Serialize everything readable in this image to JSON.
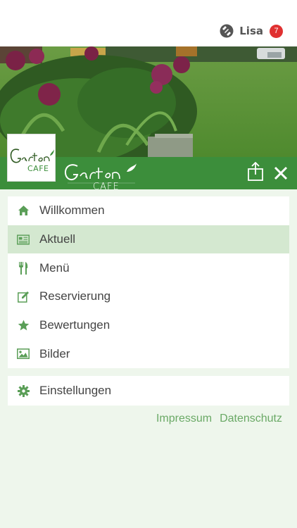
{
  "header": {
    "user_name": "Lisa",
    "notification_count": "7"
  },
  "brand": {
    "logo_icon": "garten-cafe-logo",
    "banner_icon": "garten-cafe-wordmark"
  },
  "actions": {
    "share_icon": "share-icon",
    "close_icon": "close-icon"
  },
  "menu": {
    "items": [
      {
        "label": "Willkommen",
        "icon": "home-icon"
      },
      {
        "label": "Aktuell",
        "icon": "news-icon",
        "active": true
      },
      {
        "label": "Menü",
        "icon": "cutlery-icon"
      },
      {
        "label": "Reservierung",
        "icon": "edit-icon"
      },
      {
        "label": "Bewertungen",
        "icon": "star-icon"
      },
      {
        "label": "Bilder",
        "icon": "image-icon"
      }
    ],
    "settings": {
      "label": "Einstellungen",
      "icon": "gear-icon"
    }
  },
  "footer": {
    "impressum": "Impressum",
    "datenschutz": "Datenschutz"
  },
  "colors": {
    "accent": "#3c8e3b",
    "icon": "#5a9e57",
    "active_bg": "#d4e8d0",
    "page_bg": "#eef6ec",
    "badge": "#e03131"
  }
}
